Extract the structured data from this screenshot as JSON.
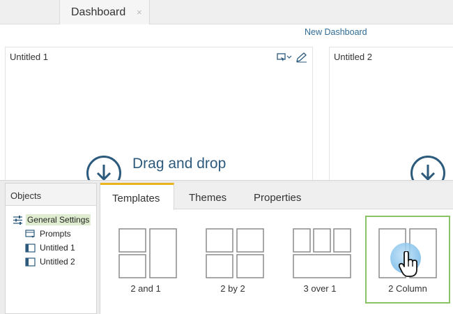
{
  "top_tab": {
    "label": "Dashboard",
    "close": "×"
  },
  "header": {
    "new_dashboard": "New Dashboard"
  },
  "panels": [
    {
      "title": "Untitled 1"
    },
    {
      "title": "Untitled 2"
    }
  ],
  "drop_hint": "Drag and drop",
  "objects": {
    "title": "Objects",
    "items": [
      {
        "label": "General Settings",
        "icon": "settings-sliders-icon"
      },
      {
        "label": "Prompts",
        "icon": "prompts-icon"
      },
      {
        "label": "Untitled 1",
        "icon": "panel-icon"
      },
      {
        "label": "Untitled 2",
        "icon": "panel-icon"
      }
    ]
  },
  "tabs": [
    {
      "label": "Templates",
      "active": true
    },
    {
      "label": "Themes",
      "active": false
    },
    {
      "label": "Properties",
      "active": false
    }
  ],
  "templates": [
    {
      "label": "2 and 1"
    },
    {
      "label": "2 by 2"
    },
    {
      "label": "3 over 1"
    },
    {
      "label": "2 Column",
      "selected": true
    }
  ],
  "colors": {
    "accent_tab": "#e8b61c",
    "selected_border": "#8ac268",
    "drop_blue": "#2b5a7d",
    "link": "#2f6b96"
  }
}
